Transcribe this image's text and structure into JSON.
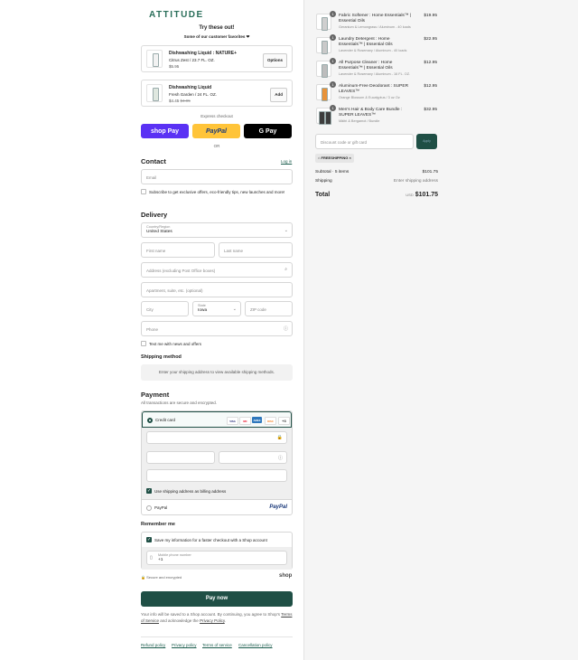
{
  "brand": {
    "logo": "ATTITUDE"
  },
  "upsell": {
    "title": "Try these out!",
    "subtitle": "Some of our customer favorites ❤",
    "items": [
      {
        "name": "Dishwashing Liquid : NATURE+",
        "variant": "Citrus Zest / 23.7 FL. OZ.",
        "price": "$5.95",
        "compare_price": "",
        "action": "Options"
      },
      {
        "name": "Dishwashing Liquid",
        "variant": "Fresh Garden / 24 FL. OZ.",
        "price": "$4.45",
        "compare_price": "$4.95",
        "action": "Add"
      }
    ]
  },
  "express": {
    "label": "Express checkout",
    "shoppay": "shop Pay",
    "paypal": "PayPal",
    "gpay": "G Pay",
    "or": "OR"
  },
  "contact": {
    "heading": "Contact",
    "login": "Log in",
    "email_placeholder": "Email",
    "subscribe_label": "Subscribe to get exclusive offers, eco-friendly tips, new launches and more!"
  },
  "delivery": {
    "heading": "Delivery",
    "country_label": "Country/Region",
    "country_value": "United States",
    "first_name": "First name",
    "last_name": "Last name",
    "address": "Address (excluding Post Office boxes)",
    "apartment": "Apartment, suite, etc. (optional)",
    "city": "City",
    "state_label": "State",
    "state_value": "Iowa",
    "zip": "ZIP code",
    "phone": "Phone",
    "text_me": "Text me with news and offers"
  },
  "shipping_method": {
    "heading": "Shipping method",
    "notice": "Enter your shipping address to view available shipping methods."
  },
  "payment": {
    "heading": "Payment",
    "subtitle": "All transactions are secure and encrypted.",
    "credit_card": "Credit card",
    "cards": [
      "VISA",
      "MC",
      "AMEX",
      "DISC"
    ],
    "more_cards": "+3",
    "billing_same": "Use shipping address as billing address",
    "paypal_label": "PayPal",
    "paypal_logo": "PayPal"
  },
  "remember": {
    "heading": "Remember me",
    "save_label": "Save my information for a faster checkout with a Shop account",
    "mobile_label": "Mobile phone number",
    "mobile_value": "+1",
    "secure": "Secure and encrypted",
    "shop": "shop"
  },
  "pay_now": "Pay now",
  "fine_print": {
    "before": "Your info will be saved to a Shop account. By continuing, you agree to Shop's ",
    "terms": "Terms of Service",
    "middle": " and acknowledge the ",
    "privacy": "Privacy Policy",
    "after": "."
  },
  "footer": [
    "Refund policy",
    "Privacy policy",
    "Terms of service",
    "Cancellation policy"
  ],
  "order": {
    "items": [
      {
        "qty": "1",
        "name": "Fabric Softener : Home Essentials™ | Essential Oils",
        "variant": "Geranium & Lemongrass / Aluminum - 40 loads",
        "price": "$19.95",
        "color": "#cfcfcf"
      },
      {
        "qty": "1",
        "name": "Laundry Detergent : Home Essentials™ | Essential Oils",
        "variant": "Lavender & Rosemary / Aluminum - 40 loads",
        "price": "$22.95",
        "color": "#c9c9c9"
      },
      {
        "qty": "1",
        "name": "All Purpose Cleaner : Home Essentials™ | Essential Oils",
        "variant": "Lavender & Rosemary / Aluminum - 16 FL. OZ.",
        "price": "$12.95",
        "color": "#bdbdbd"
      },
      {
        "qty": "1",
        "name": "Aluminum-Free Deodorant : SUPER LEAVES™",
        "variant": "Orange Blossom & Eucalyptus / 3 oz Oz",
        "price": "$12.95",
        "color": "#e8933a"
      },
      {
        "qty": "1",
        "name": "Men's Hair & Body Care Bundle : SUPER LEAVES™",
        "variant": "Mäitri & Bergamot / Bundle",
        "price": "$32.95",
        "color": "#3d3d3d"
      }
    ],
    "discount_placeholder": "Discount code or gift card",
    "apply": "Apply",
    "applied_code": "FREESHIPPING",
    "subtotal_label": "Subtotal · 5 items",
    "subtotal_value": "$101.75",
    "shipping_label": "Shipping",
    "shipping_value": "Enter shipping address",
    "total_label": "Total",
    "total_currency": "USD",
    "total_value": "$101.75"
  }
}
